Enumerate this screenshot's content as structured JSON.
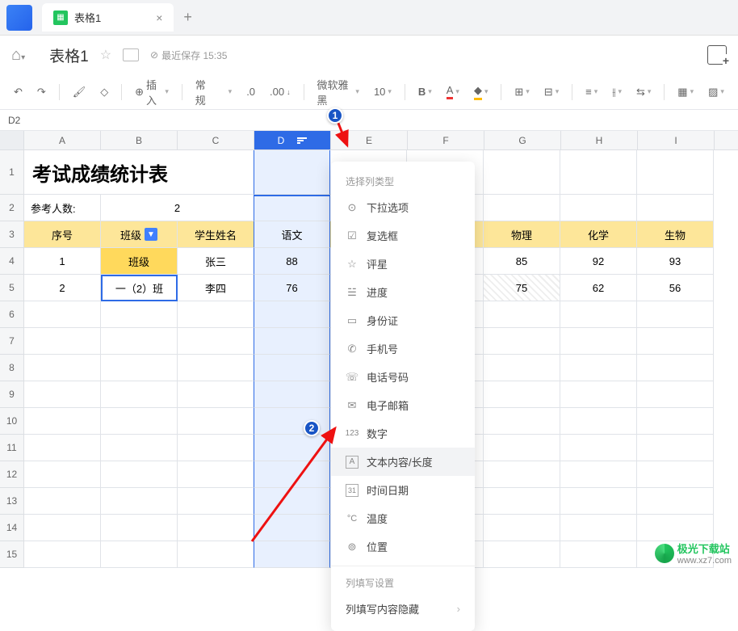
{
  "tabs": {
    "title": "表格1",
    "add": "+"
  },
  "titlebar": {
    "title": "表格1",
    "save_status": "最近保存 15:35"
  },
  "toolbar": {
    "insert": "插入",
    "format": "常规",
    "decimals": ".0",
    "dec_add": ".00",
    "font": "微软雅黑",
    "fontsize": "10",
    "bold": "B",
    "font_color": "A"
  },
  "namebox": "D2",
  "columns": [
    "A",
    "B",
    "C",
    "D",
    "E",
    "F",
    "G",
    "H",
    "I"
  ],
  "rows": [
    "1",
    "2",
    "3",
    "4",
    "5",
    "6",
    "7",
    "8",
    "9",
    "10",
    "11",
    "12",
    "13",
    "14",
    "15"
  ],
  "big_title": "考试成绩统计表",
  "r2": {
    "label": "参考人数:",
    "value": "2"
  },
  "headers": {
    "a": "序号",
    "b": "班级",
    "c": "学生姓名",
    "d": "语文",
    "g": "物理",
    "h": "化学",
    "i": "生物"
  },
  "r4": {
    "a": "1",
    "b": "班级",
    "c": "张三",
    "d": "88",
    "g": "85",
    "h": "92",
    "i": "93"
  },
  "r5": {
    "a": "2",
    "b": "一（2）班",
    "c": "李四",
    "d": "76",
    "g": "75",
    "h": "62",
    "i": "56"
  },
  "popup": {
    "section1": "选择列类型",
    "dropdown": "下拉选项",
    "checkbox": "复选框",
    "rating": "评星",
    "progress": "进度",
    "idcard": "身份证",
    "phone": "手机号",
    "telephone": "电话号码",
    "email": "电子邮箱",
    "number": "数字",
    "number_prefix": "123",
    "text": "文本内容/长度",
    "datetime": "时间日期",
    "date_prefix": "31",
    "temperature": "温度",
    "temp_prefix": "°C",
    "location": "位置",
    "section2": "列填写设置",
    "hidecontent": "列填写内容隐藏"
  },
  "watermark": {
    "brand": "极光下载站",
    "url": "www.xz7.com"
  }
}
